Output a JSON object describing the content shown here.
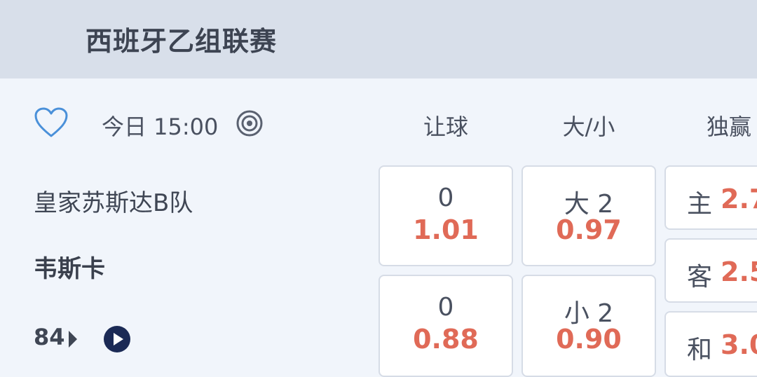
{
  "header": {
    "title": "西班牙乙组联赛"
  },
  "match": {
    "time": "今日 15:00",
    "home_team": "皇家苏斯达B队",
    "away_team": "韦斯卡",
    "minute": "84"
  },
  "columns": {
    "handicap": "让球",
    "over_under": "大/小",
    "win_draw_win": "独赢"
  },
  "handicap": [
    {
      "line": "0",
      "price": "1.01"
    },
    {
      "line": "0",
      "price": "0.88"
    }
  ],
  "over_under": [
    {
      "line": "大 2",
      "price": "0.97"
    },
    {
      "line": "小 2",
      "price": "0.90"
    }
  ],
  "win_draw_win": [
    {
      "label": "主",
      "price": "2.7"
    },
    {
      "label": "客",
      "price": "2.5"
    },
    {
      "label": "和",
      "price": "3.0"
    }
  ],
  "colors": {
    "accent": "#e06a57",
    "header_bg": "#d8dfea",
    "icon_blue": "#4a90d9"
  },
  "icons": {
    "favorite": "heart-outline-icon",
    "stats": "target-icon",
    "live": "play-circle-icon"
  }
}
